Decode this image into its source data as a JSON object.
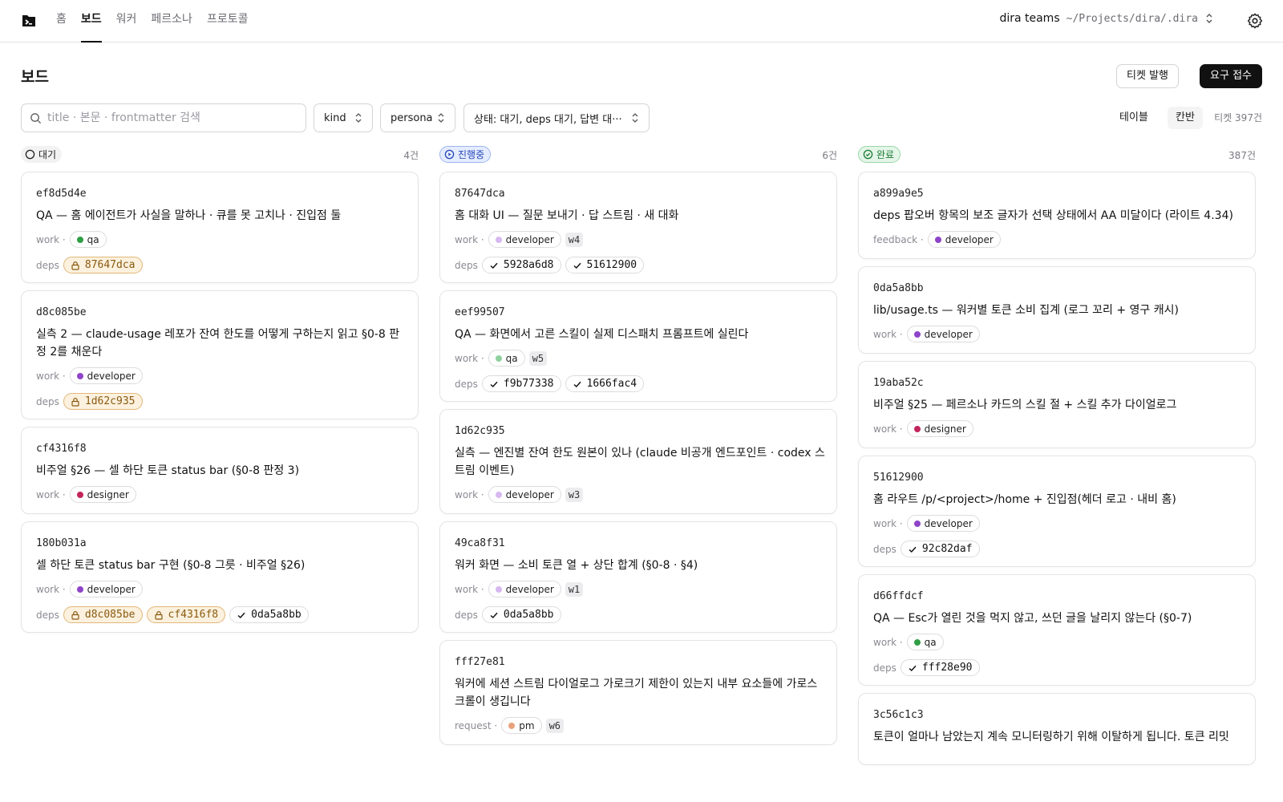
{
  "nav": {
    "items": [
      "홈",
      "보드",
      "워커",
      "페르소나",
      "프로토콜"
    ],
    "active": 1
  },
  "project": {
    "name": "dira teams",
    "path": "~/Projects/dira/.dira"
  },
  "page": {
    "title": "보드"
  },
  "actions": {
    "issue_ticket": "티켓 발행",
    "intake": "요구 접수"
  },
  "filters": {
    "search_placeholder": "title · 본문 · frontmatter 검색",
    "kind": "kind",
    "persona": "persona",
    "status": "상태: 대기, deps 대기, 답변 대···"
  },
  "view": {
    "table": "테이블",
    "kanban": "칸반",
    "active": "kanban",
    "total": "티켓 397건"
  },
  "colors": {
    "qa": "#2f9e44",
    "qa_light": "#8fd19e",
    "developer": "#8e44c9",
    "developer_light": "#d7b8f0",
    "designer": "#c2255c",
    "pm": "#e8a27c",
    "accent": "#2746b8",
    "lock": "#8a5a10"
  },
  "columns": [
    {
      "status": "대기",
      "icon": "circle-icon",
      "count": "4건",
      "cards": [
        {
          "id": "ef8d5d4e",
          "title": "QA — 홈 에이전트가 사실을 말하나 · 큐를 못 고치나 · 진입점 둘",
          "kind": "work ·",
          "persona": "qa",
          "dot": "qa",
          "w": "",
          "deps_label": "deps",
          "deps": [
            {
              "id": "87647dca",
              "state": "lock"
            }
          ]
        },
        {
          "id": "d8c085be",
          "title": "실측 2 — claude-usage 레포가 잔여 한도를 어떻게 구하는지 읽고 §0-8 판정 2를 채운다",
          "kind": "work ·",
          "persona": "developer",
          "dot": "developer",
          "w": "",
          "deps_label": "deps",
          "deps": [
            {
              "id": "1d62c935",
              "state": "lock"
            }
          ]
        },
        {
          "id": "cf4316f8",
          "title": "비주얼 §26 — 셀 하단 토큰 status bar (§0-8 판정 3)",
          "kind": "work ·",
          "persona": "designer",
          "dot": "designer",
          "w": "",
          "deps_label": "",
          "deps": []
        },
        {
          "id": "180b031a",
          "title": "셀 하단 토큰 status bar 구현 (§0-8 그릇 · 비주얼 §26)",
          "kind": "work ·",
          "persona": "developer",
          "dot": "developer",
          "w": "",
          "deps_label": "deps",
          "deps": [
            {
              "id": "d8c085be",
              "state": "lock"
            },
            {
              "id": "cf4316f8",
              "state": "lock"
            },
            {
              "id": "0da5a8bb",
              "state": "ok"
            }
          ]
        }
      ]
    },
    {
      "status": "진행중",
      "icon": "play-circle-icon",
      "count": "6건",
      "cards": [
        {
          "id": "87647dca",
          "title": "홈 대화 UI — 질문 보내기 · 답 스트림 · 새 대화",
          "kind": "work ·",
          "persona": "developer",
          "dot": "developer_light",
          "w": "w4",
          "deps_label": "deps",
          "deps": [
            {
              "id": "5928a6d8",
              "state": "ok"
            },
            {
              "id": "51612900",
              "state": "ok"
            }
          ]
        },
        {
          "id": "eef99507",
          "title": "QA — 화면에서 고른 스킬이 실제 디스패치 프롬프트에 실린다",
          "kind": "work ·",
          "persona": "qa",
          "dot": "qa_light",
          "w": "w5",
          "deps_label": "deps",
          "deps": [
            {
              "id": "f9b77338",
              "state": "ok"
            },
            {
              "id": "1666fac4",
              "state": "ok"
            }
          ]
        },
        {
          "id": "1d62c935",
          "title": "실측 — 엔진별 잔여 한도 원본이 있나 (claude 비공개 엔드포인트 · codex 스트림 이벤트)",
          "kind": "work ·",
          "persona": "developer",
          "dot": "developer_light",
          "w": "w3",
          "deps_label": "",
          "deps": []
        },
        {
          "id": "49ca8f31",
          "title": "워커 화면 — 소비 토큰 열 + 상단 합계 (§0-8 · §4)",
          "kind": "work ·",
          "persona": "developer",
          "dot": "developer_light",
          "w": "w1",
          "deps_label": "deps",
          "deps": [
            {
              "id": "0da5a8bb",
              "state": "ok"
            }
          ]
        },
        {
          "id": "fff27e81",
          "title": "워커에 세션 스트림 다이얼로그 가로크기 제한이 있는지 내부 요소들에 가로스크롤이 생깁니다",
          "kind": "request ·",
          "persona": "pm",
          "dot": "pm",
          "w": "w6",
          "deps_label": "",
          "deps": []
        }
      ]
    },
    {
      "status": "완료",
      "icon": "check-circle-icon",
      "count": "387건",
      "cards": [
        {
          "id": "a899a9e5",
          "title": "deps 팝오버 항목의 보조 글자가 선택 상태에서 AA 미달이다 (라이트 4.34)",
          "kind": "feedback ·",
          "persona": "developer",
          "dot": "developer",
          "w": "",
          "deps_label": "",
          "deps": []
        },
        {
          "id": "0da5a8bb",
          "title": "lib/usage.ts — 워커별 토큰 소비 집계 (로그 꼬리 + 영구 캐시)",
          "kind": "work ·",
          "persona": "developer",
          "dot": "developer",
          "w": "",
          "deps_label": "",
          "deps": []
        },
        {
          "id": "19aba52c",
          "title": "비주얼 §25 — 페르소나 카드의 스킬 절 + 스킬 추가 다이얼로그",
          "kind": "work ·",
          "persona": "designer",
          "dot": "designer",
          "w": "",
          "deps_label": "",
          "deps": []
        },
        {
          "id": "51612900",
          "title": "홈 라우트 /p/<project>/home + 진입점(헤더 로고 · 내비 홈)",
          "kind": "work ·",
          "persona": "developer",
          "dot": "developer",
          "w": "",
          "deps_label": "deps",
          "deps": [
            {
              "id": "92c82daf",
              "state": "ok"
            }
          ]
        },
        {
          "id": "d66ffdcf",
          "title": "QA — Esc가 열린 것을 먹지 않고, 쓰던 글을 날리지 않는다 (§0-7)",
          "kind": "work ·",
          "persona": "qa",
          "dot": "qa",
          "w": "",
          "deps_label": "deps",
          "deps": [
            {
              "id": "fff28e90",
              "state": "ok"
            }
          ]
        },
        {
          "id": "3c56c1c3",
          "title": "토큰이 얼마나 남았는지 계속 모니터링하기 위해 이탈하게 됩니다. 토큰 리밋",
          "kind": "",
          "persona": "",
          "dot": "",
          "w": "",
          "deps_label": "",
          "deps": []
        }
      ]
    }
  ]
}
